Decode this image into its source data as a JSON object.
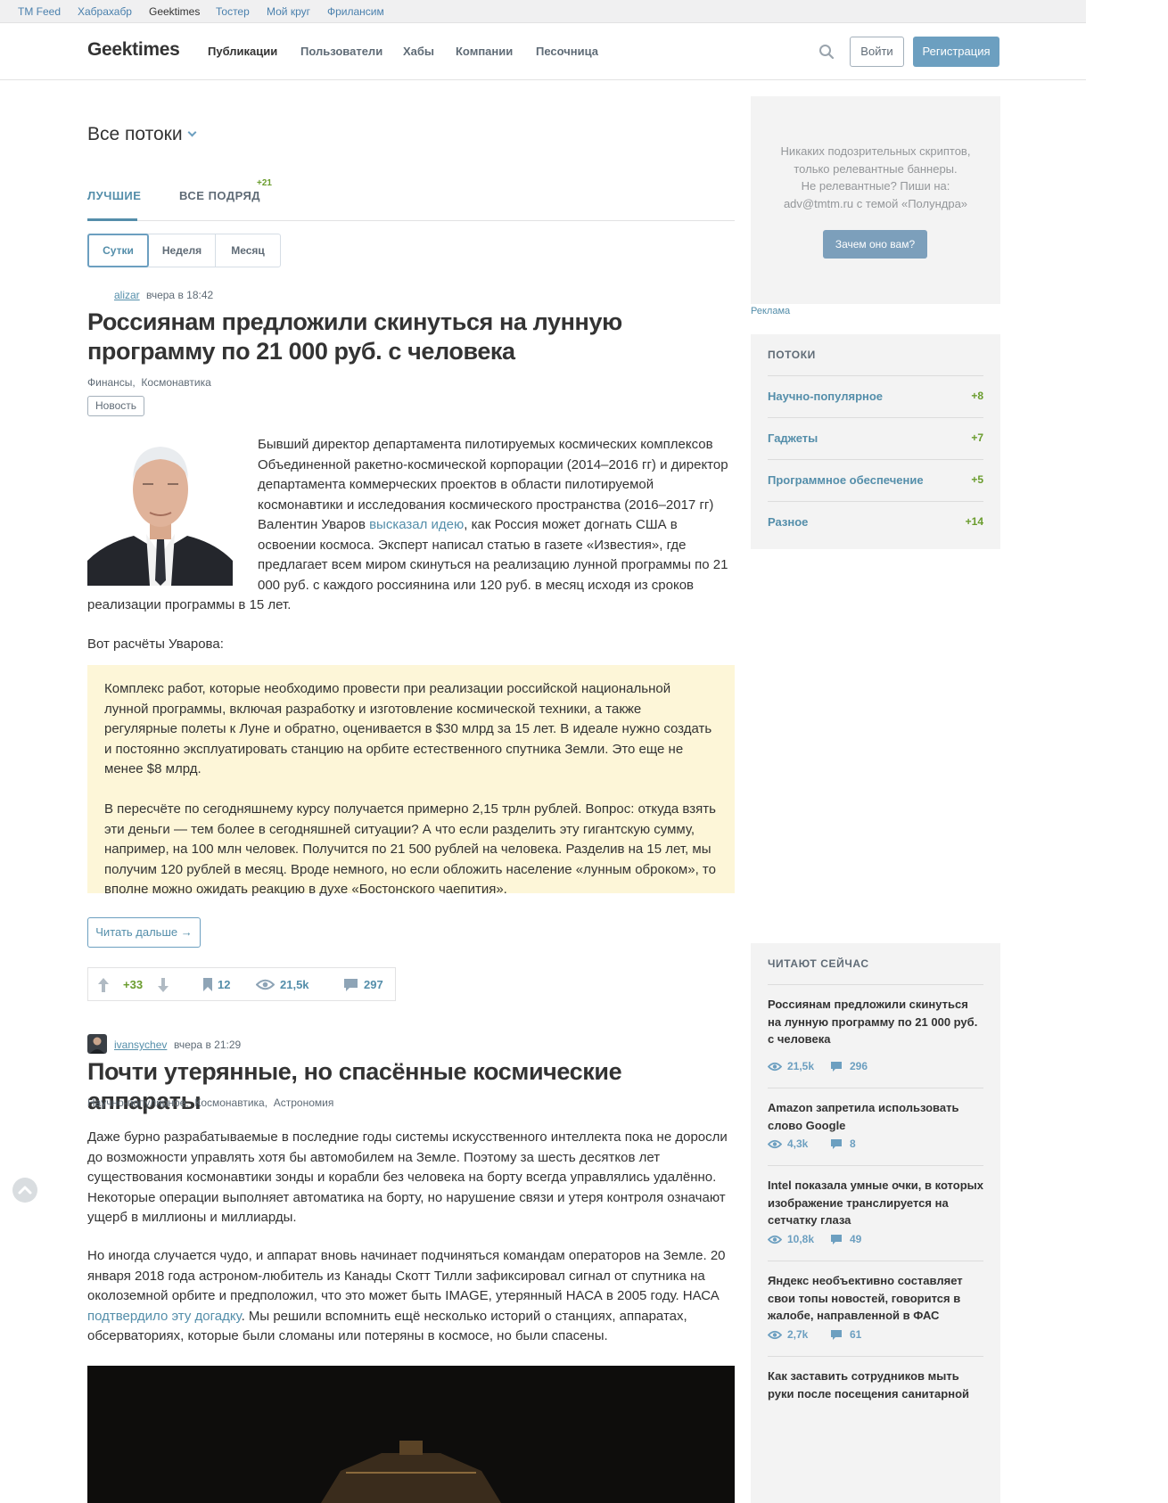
{
  "topbar": {
    "links": [
      "TM Feed",
      "Хабрахабр",
      "Geektimes",
      "Тостер",
      "Мой круг",
      "Фрилансим"
    ],
    "active": "Geektimes"
  },
  "header": {
    "logo": "Geektimes",
    "nav": [
      "Публикации",
      "Пользователи",
      "Хабы",
      "Компании",
      "Песочница"
    ],
    "login": "Войти",
    "register": "Регистрация"
  },
  "feed": {
    "streams_title": "Все потоки",
    "tabs": [
      "ЛУЧШИЕ",
      "ВСЕ ПОДРЯД"
    ],
    "all_count": "+21",
    "periods": [
      "Сутки",
      "Неделя",
      "Месяц"
    ],
    "active_period": "Сутки"
  },
  "post1": {
    "author": "alizar",
    "time": "вчера в 18:42",
    "title": "Россиянам предложили скинуться на лунную программу по 21 000 руб. с человека",
    "hubs": [
      "Финансы",
      "Космонавтика"
    ],
    "badge": "Новость",
    "p1_before": "Бывший директор департамента пилотируемых космических комплексов Объединенной ракетно-космической корпорации (2014–2016 гг) и директор департамента коммерческих проектов в области пилотируемой космонавтики и исследования космического пространства (2016–2017 гг) Валентин Уваров ",
    "p1_link": "высказал идею",
    "p1_after": ", как Россия может догнать США в освоении космоса. Эксперт написал статью в газете «Известия», где предлагает всем миром скинуться на реализацию лунной программы по 21 000 руб. с каждого россиянина или 120 руб. в месяц исходя из сроков реализации программы в 15 лет.",
    "calc": "Вот расчёты Уварова:",
    "quote1": "Комплекс работ, которые необходимо провести при реализации российской национальной лунной программы, включая разработку и изготовление космической техники, а также регулярные полеты к Луне и обратно, оценивается в $30 млрд за 15 лет. В идеале нужно создать и постоянно эксплуатировать станцию на орбите естественного спутника Земли. Это еще не менее $8 млрд.",
    "quote2": "В пересчёте по сегодняшнему курсу получается примерно 2,15 трлн рублей. Вопрос: откуда взять эти деньги — тем более в сегодняшней ситуации? А что если разделить эту гигантскую сумму, например, на 100 млн человек. Получится по 21 500 рублей на человека. Разделив на 15 лет, мы получим 120 рублей в месяц. Вроде немного, но если обложить население «лунным оброком», то вполне можно ожидать реакцию в духе «Бостонского чаепития».",
    "read_more": "Читать дальше →",
    "votes": "+33",
    "bookmarks": "12",
    "views": "21,5k",
    "comments": "297"
  },
  "post2": {
    "author": "ivansychev",
    "time": "вчера в 21:29",
    "title": "Почти утерянные, но спасённые космические аппараты",
    "hubs": [
      "Научно-популярное",
      "Космонавтика",
      "Астрономия"
    ],
    "p1": "Даже бурно разрабатываемые в последние годы системы искусственного интеллекта пока не доросли до возможности управлять хотя бы автомобилем на Земле. Поэтому за шесть десятков лет существования космонавтики зонды и корабли без человека на борту всегда управлялись удалённо. Некоторые операции выполняет автоматика на борту, но нарушение связи и утеря контроля означают ущерб в миллионы и миллиарды.",
    "p2_before": "Но иногда случается чудо, и аппарат вновь начинает подчиняться командам операторов на Земле. 20 января 2018 года астроном-любитель из Канады Скотт Тилли зафиксировал сигнал от спутника на околоземной орбите и предположил, что это может быть IMAGE, утерянный НАСА в 2005 году. НАСА ",
    "p2_link": "подтвердило эту догадку",
    "p2_after": ". Мы решили вспомнить ещё несколько историй о станциях, аппаратах, обсерваториях, которые были сломаны или потеряны в космосе, но были спасены."
  },
  "sidebar": {
    "adv_line1": "Никаких подозрительных скриптов,",
    "adv_line2": "только релевантные баннеры.",
    "adv_line3": "Не релевантные? Пиши на:",
    "adv_line4": "adv@tmtm.ru с темой «Полундра»",
    "adv_button": "Зачем оно вам?",
    "ad_label": "Реклама",
    "flows_title": "ПОТОКИ",
    "flows": [
      {
        "name": "Научно-популярное",
        "count": "+8"
      },
      {
        "name": "Гаджеты",
        "count": "+7"
      },
      {
        "name": "Программное обеспечение",
        "count": "+5"
      },
      {
        "name": "Разное",
        "count": "+14"
      }
    ],
    "reading_title": "ЧИТАЮТ СЕЙЧАС",
    "reading": [
      {
        "title": "Россиянам предложили скинуться на лунную программу по 21 000 руб. с человека",
        "views": "21,5k",
        "comments": "296"
      },
      {
        "title": "Amazon запретила использовать слово Google",
        "views": "4,3k",
        "comments": "8"
      },
      {
        "title": "Intel показала умные очки, в которых изображение транслируется на сетчатку глаза",
        "views": "10,8k",
        "comments": "49"
      },
      {
        "title": "Яндекс необъективно составляет свои топы новостей, говорится в жалобе, направленной в ФАС",
        "views": "2,7k",
        "comments": "61"
      },
      {
        "title": "Как заставить сотрудников мыть руки после посещения санитарной",
        "views": "",
        "comments": ""
      }
    ]
  }
}
